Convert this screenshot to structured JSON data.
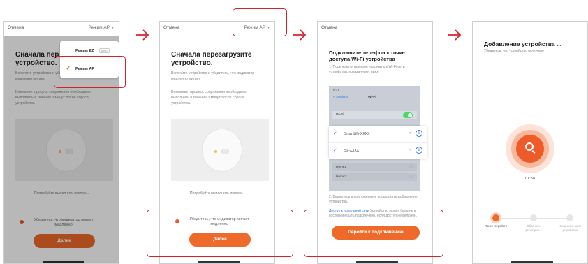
{
  "colors": {
    "accent": "#ee6a2b",
    "highlight": "#d6232b",
    "link": "#2d7be0"
  },
  "screen1": {
    "cancel": "Отмена",
    "mode": "Режим AP",
    "title_line1": "Сначала пер",
    "title_line2": "устройство.",
    "dropdown": {
      "item1_label": "Режим EZ",
      "item1_tag": "ВКЛ",
      "item2_label": "Режим AP"
    },
    "text1": "Включите устройство и убедитесь, что индикатор медленно мигает.",
    "text2": "Внимание: процесс сопряжения необходимо выполнить в течение 3 минут после сброса устройства.",
    "hint": "Попробуйте выполнить повтор...",
    "confirm": "Убедитесь, что индикатор мигает медленно",
    "next": "Далее"
  },
  "screen2": {
    "cancel": "Отмена",
    "mode": "Режим AP",
    "title_line1": "Сначала перезагрузите",
    "title_line2": "устройство.",
    "text1": "Включите устройство и убедитесь, что индикатор медленно мигает.",
    "text2": "Внимание: процесс сопряжения необходимо выполнить в течение 3 минут после сброса устройства.",
    "hint": "Попробуйте выполнить повтор...",
    "confirm": "Убедитесь, что индикатор мигает медленно",
    "next": "Далее"
  },
  "screen3": {
    "cancel": "Отмена",
    "title_line1": "Подключите телефон к точке",
    "title_line2": "доступа Wi-Fi устройства",
    "step1": "1. Подключите телефон напрямую к Wi-Fi сети устройства, показанному ниже",
    "wifi": {
      "status_time": "9:41",
      "back": "< Settings",
      "header": "Wi-Fi",
      "row_wifi": "Wi-Fi",
      "net1": "SmartLife-XXXX",
      "net2": "SL-XXXX",
      "dim1": "Home1",
      "dim2": "Home2"
    },
    "step2": "2. Вернитесь в приложение и продолжите добавление устройства.",
    "note_link": "Доступ к локальной сети",
    "note_rest": "Устройство может быть не в состоянии быть подключено, если доступ не включен.",
    "connect": "Перейти к подключению"
  },
  "screen4": {
    "title": "Добавление устройства ...",
    "subtitle": "Убедитесь, что устройство включено",
    "timer": "01:58",
    "steps": [
      "Поиск устройств",
      "Облачное регистрир...",
      "Инициализ ация устройства"
    ]
  }
}
